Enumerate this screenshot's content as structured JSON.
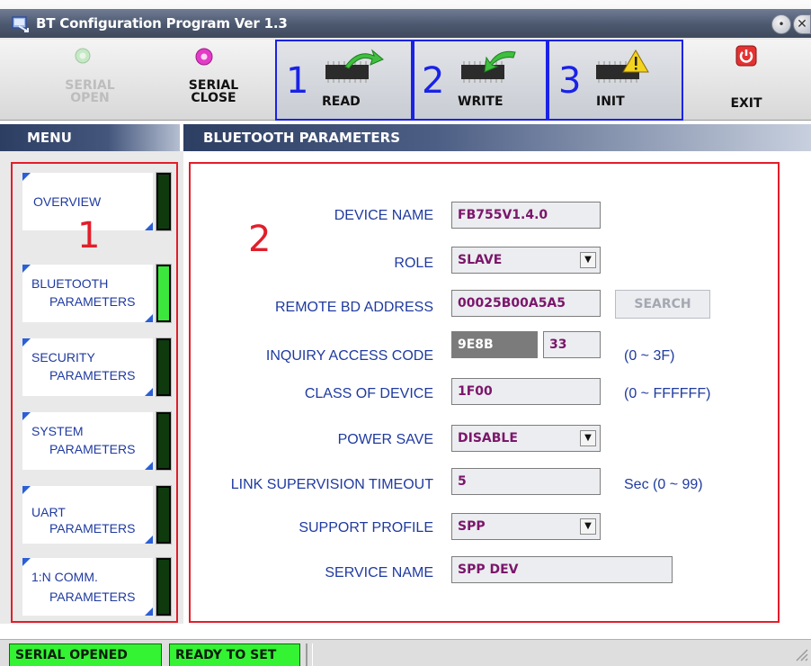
{
  "window": {
    "title": "BT Configuration Program Ver 1.3"
  },
  "toolbar": {
    "serial_open_label_1": "SERIAL",
    "serial_open_label_2": "OPEN",
    "serial_close_label_1": "SERIAL",
    "serial_close_label_2": "CLOSE",
    "read_num": "1",
    "read_label": "READ",
    "write_num": "2",
    "write_label": "WRITE",
    "init_num": "3",
    "init_label": "INIT",
    "exit_label": "EXIT"
  },
  "menu": {
    "header": "MENU",
    "annotation_num": "1",
    "items": [
      {
        "line1": "OVERVIEW",
        "line2": "",
        "led": "off"
      },
      {
        "line1": "BLUETOOTH",
        "line2": "PARAMETERS",
        "led": "on"
      },
      {
        "line1": "SECURITY",
        "line2": "PARAMETERS",
        "led": "off"
      },
      {
        "line1": "SYSTEM",
        "line2": "PARAMETERS",
        "led": "off"
      },
      {
        "line1": "UART",
        "line2": "PARAMETERS",
        "led": "off"
      },
      {
        "line1": "1:N COMM.",
        "line2": "PARAMETERS",
        "led": "off"
      }
    ]
  },
  "params": {
    "header": "BLUETOOTH PARAMETERS",
    "annotation_num": "2",
    "device_name": {
      "label": "DEVICE NAME",
      "value": "FB755V1.4.0"
    },
    "role": {
      "label": "ROLE",
      "value": "SLAVE"
    },
    "remote_bd": {
      "label": "REMOTE BD ADDRESS",
      "value": "00025B00A5A5",
      "button": "SEARCH"
    },
    "inquiry": {
      "label": "INQUIRY ACCESS CODE",
      "value1": "9E8B",
      "value2": "33",
      "range": "(0 ~ 3F)"
    },
    "class_of_device": {
      "label": "CLASS OF DEVICE",
      "value": "1F00",
      "range": "(0 ~ FFFFFF)"
    },
    "power_save": {
      "label": "POWER SAVE",
      "value": "DISABLE"
    },
    "link_timeout": {
      "label": "LINK SUPERVISION TIMEOUT",
      "value": "5",
      "range": "Sec (0 ~ 99)"
    },
    "support_profile": {
      "label": "SUPPORT PROFILE",
      "value": "SPP"
    },
    "service_name": {
      "label": "SERVICE NAME",
      "value": "SPP DEV"
    }
  },
  "status": {
    "serial": "SERIAL OPENED",
    "ready": "READY TO SET"
  },
  "colors": {
    "annotation_red": "#e21e2a",
    "annotation_blue": "#1a22e6",
    "led_on": "#3ce63c",
    "value_text": "#7b166b"
  }
}
